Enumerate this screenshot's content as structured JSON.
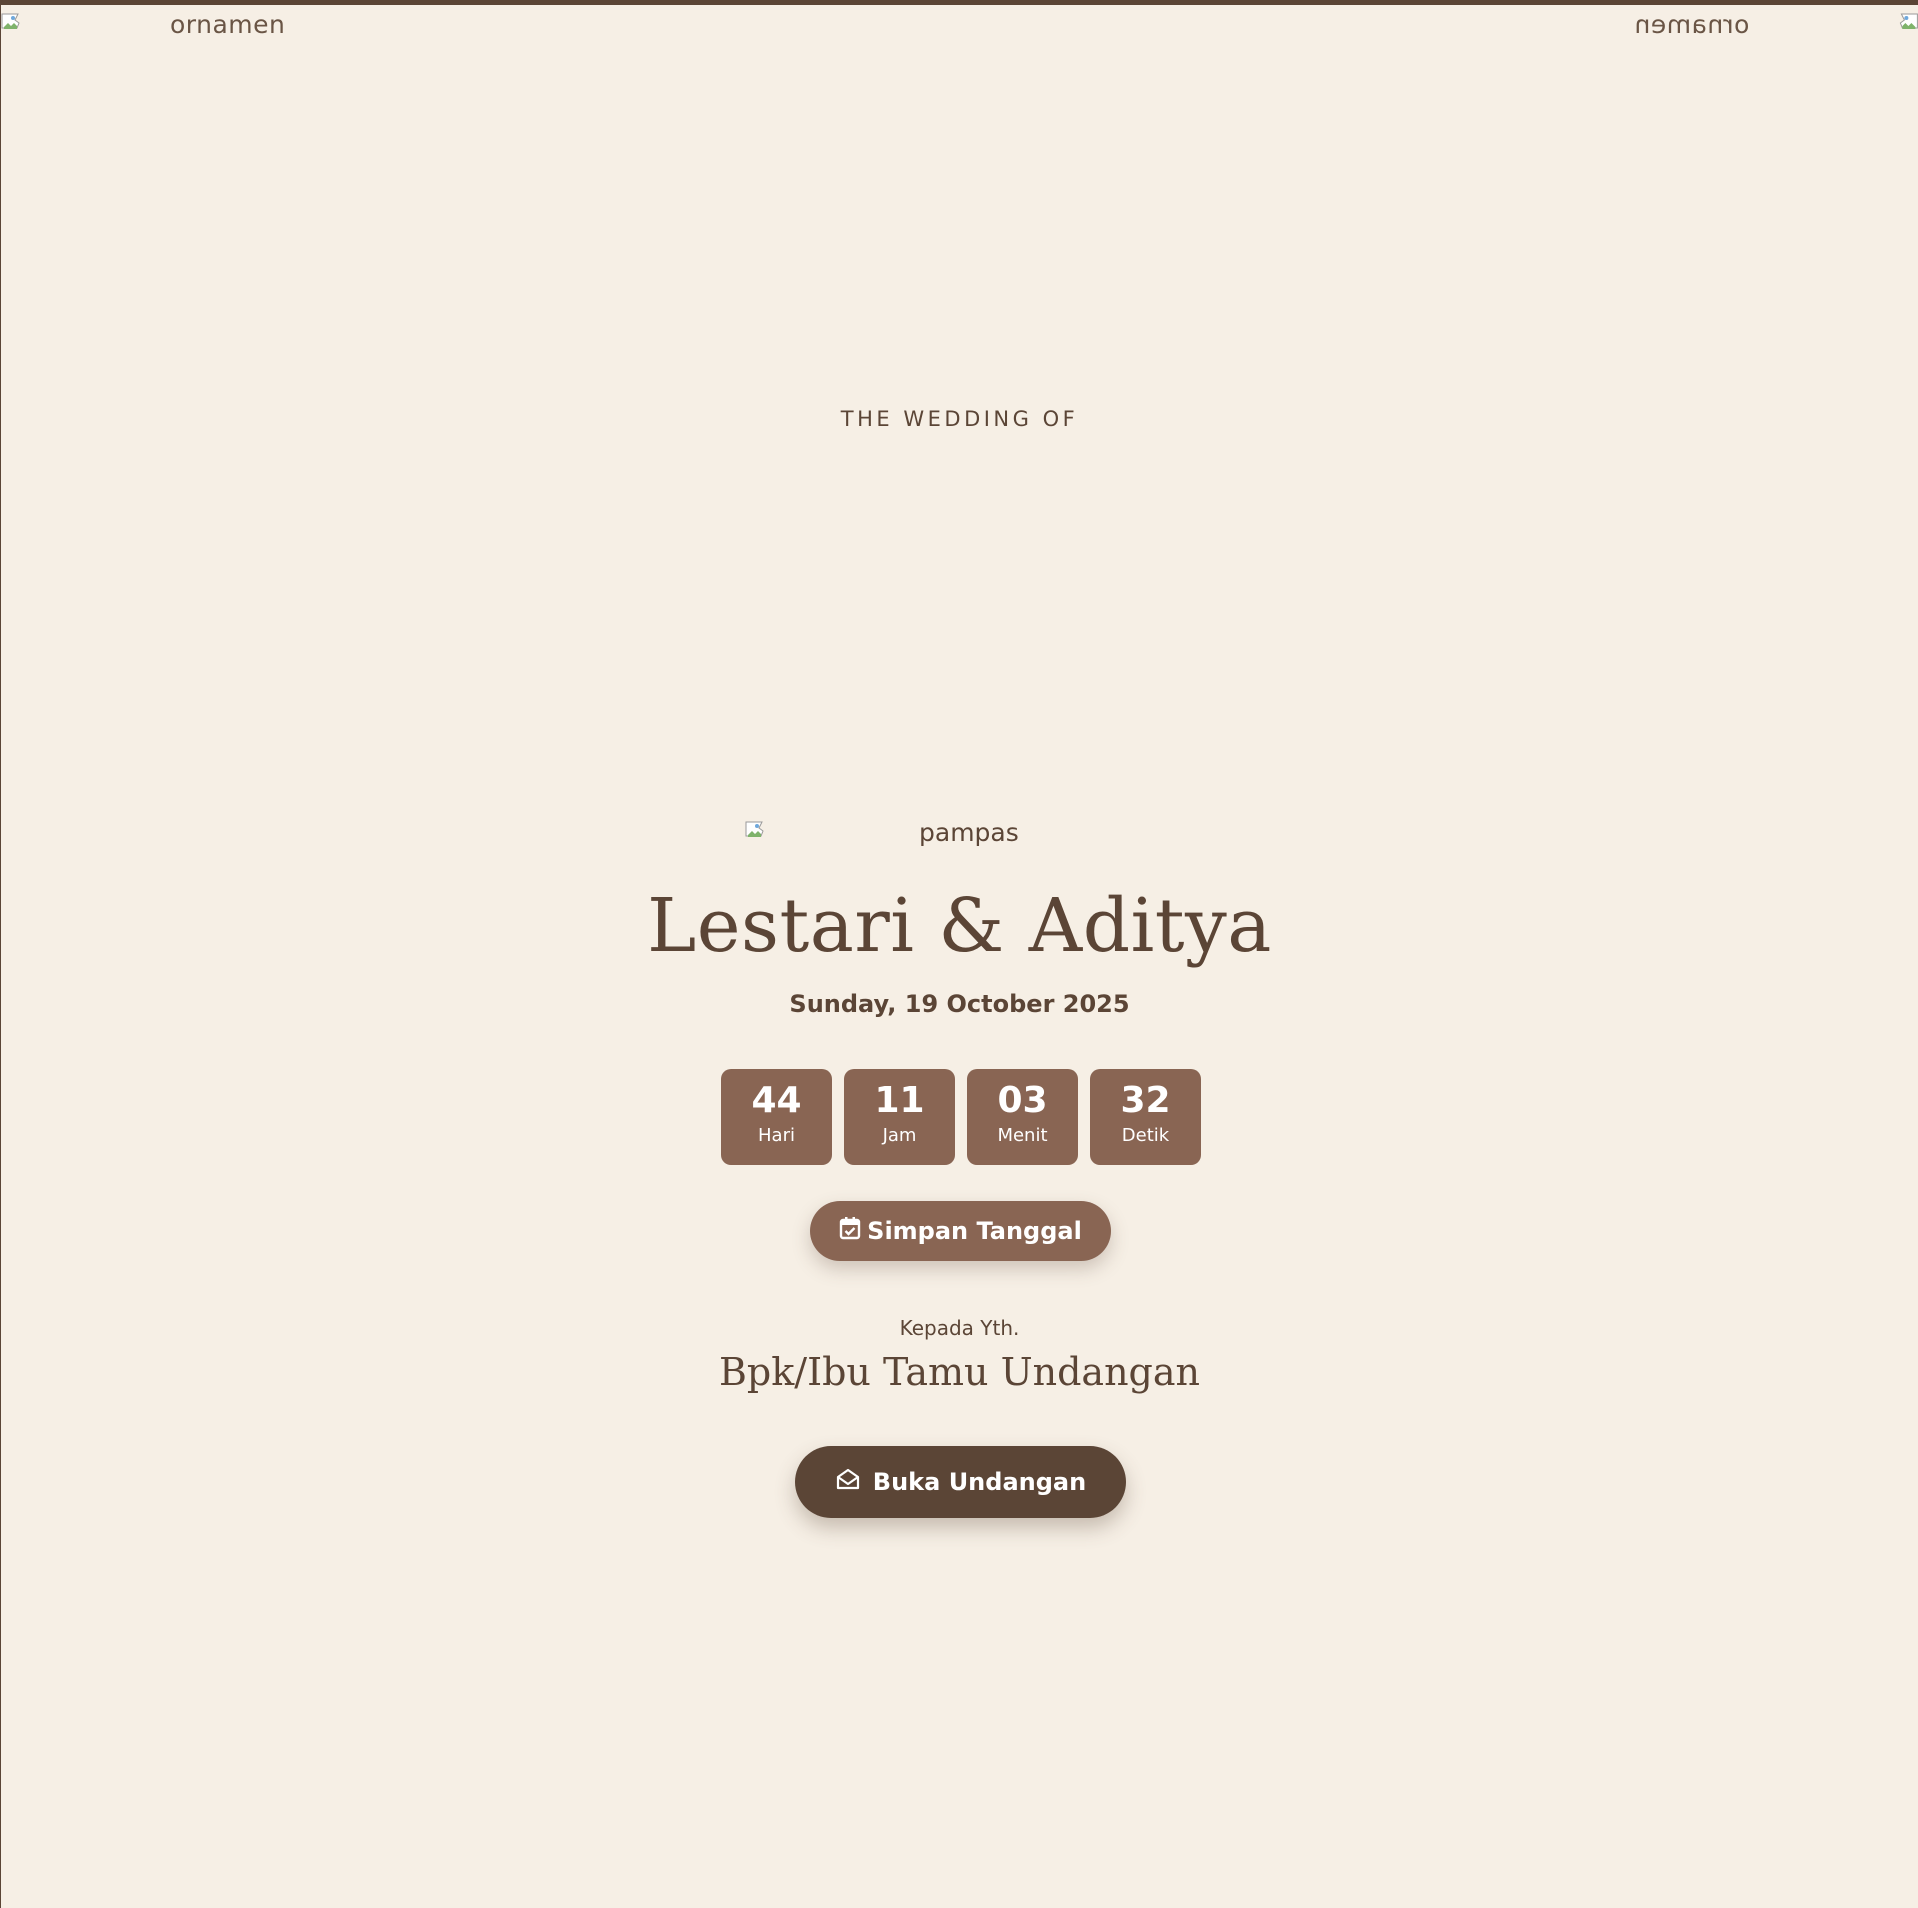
{
  "ornaments": {
    "left_alt": "ornamen",
    "right_alt": "ornamen"
  },
  "hero": {
    "overline": "THE WEDDING OF",
    "pampas_alt": "pampas",
    "couple": "Lestari & Aditya",
    "date": "Sunday, 19 October 2025"
  },
  "countdown": [
    {
      "value": "44",
      "label": "Hari"
    },
    {
      "value": "11",
      "label": "Jam"
    },
    {
      "value": "03",
      "label": "Menit"
    },
    {
      "value": "32",
      "label": "Detik"
    }
  ],
  "save_date": {
    "label": "Simpan Tanggal",
    "icon": "calendar-check-icon"
  },
  "recipient": {
    "to_label": "Kepada Yth.",
    "guest_name": "Bpk/Ibu Tamu Undangan"
  },
  "open_invitation": {
    "label": "Buka Undangan",
    "icon": "envelope-open-icon"
  },
  "colors": {
    "background": "#f6efe5",
    "primary": "#896553",
    "dark": "#5b4536",
    "top_border": "#5b4536"
  }
}
